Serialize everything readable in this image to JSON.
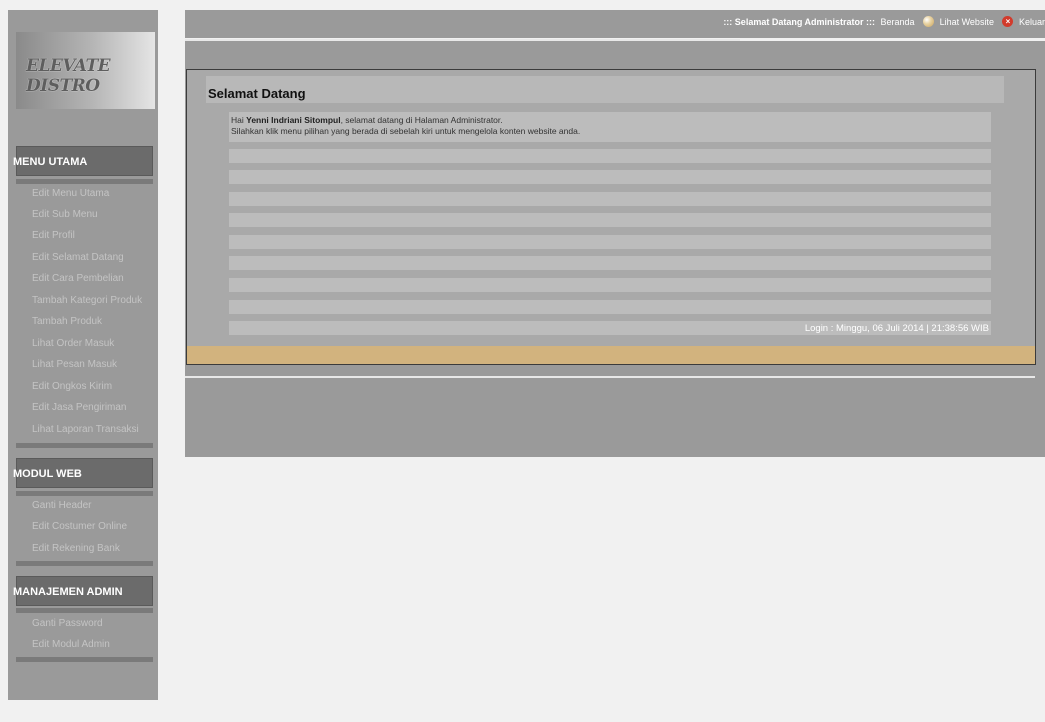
{
  "sidebar": {
    "logo_text": "ELEVATE DISTRO",
    "sections": [
      {
        "header": "MENU UTAMA",
        "items": [
          "Edit Menu Utama",
          "Edit Sub Menu",
          "Edit Profil",
          "Edit Selamat Datang",
          "Edit Cara Pembelian",
          "Tambah Kategori Produk",
          "Tambah Produk",
          "Lihat Order Masuk",
          "Lihat Pesan Masuk",
          "Edit Ongkos Kirim",
          "Edit Jasa Pengiriman",
          "Lihat Laporan Transaksi"
        ]
      },
      {
        "header": "MODUL WEB",
        "items": [
          "Ganti Header",
          "Edit Costumer Online",
          "Edit Rekening Bank"
        ]
      },
      {
        "header": "MANAJEMEN ADMIN",
        "items": [
          "Ganti Password",
          "Edit Modul Admin"
        ]
      }
    ]
  },
  "topnav": {
    "welcome": "::: Selamat Datang Administrator :::",
    "home": "Beranda",
    "view_site": "Lihat Website",
    "logout": "Keluar",
    "icons": [
      "globe-icon",
      "exit-icon"
    ]
  },
  "content": {
    "title": "Selamat Datang",
    "greeting_prefix": "Hai ",
    "user_name": "Yenni Indriani Sitompul",
    "greeting_suffix": ", selamat datang di Halaman Administrator.",
    "instruction": "Silahkan klik menu pilihan yang berada di sebelah kiri untuk mengelola konten website anda.",
    "login_info": "Login : Minggu, 06 Juli 2014 | 21:38:56 WIB"
  },
  "colors": {
    "sidebar": "#9a9a9a",
    "menu_header": "#6b6b6b",
    "content_bg": "#a9a9a9",
    "row": "#bcbcbc",
    "accent_bar": "#d2b37e"
  }
}
